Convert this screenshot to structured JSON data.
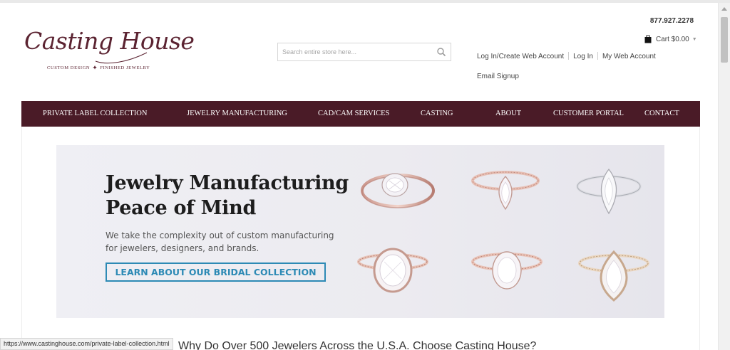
{
  "brand": {
    "name": "Casting House",
    "tagline_left": "CUSTOM DESIGN",
    "tagline_right": "FINISHED JEWELRY",
    "color": "#5b2331"
  },
  "search": {
    "placeholder": "Search entire store here...",
    "icon": "search-icon"
  },
  "header": {
    "phone": "877.927.2278",
    "cart_label": "Cart $0.00",
    "cart_icon": "shopping-bag-icon",
    "account_links": [
      "Log In/Create Web Account",
      "Log In",
      "My Web Account"
    ],
    "email_signup": "Email Signup"
  },
  "nav": {
    "background": "#4a1b27",
    "items": [
      "PRIVATE LABEL COLLECTION",
      "JEWELRY MANUFACTURING",
      "CAD/CAM SERVICES",
      "CASTING",
      "ABOUT",
      "CUSTOMER PORTAL",
      "CONTACT"
    ]
  },
  "hero": {
    "headline_line1": "Jewelry Manufacturing",
    "headline_line2": "Peace of Mind",
    "subtext_line1": "We take the complexity out of custom manufacturing",
    "subtext_line2": "for jewelers, designers, and brands.",
    "cta": "LEARN ABOUT OUR BRIDAL COLLECTION",
    "accent": "#2d8ab5"
  },
  "section": {
    "heading": "Why Do Over 500 Jewelers Across the U.S.A. Choose Casting House?"
  },
  "status_bar": {
    "url": "https://www.castinghouse.com/private-label-collection.html"
  }
}
